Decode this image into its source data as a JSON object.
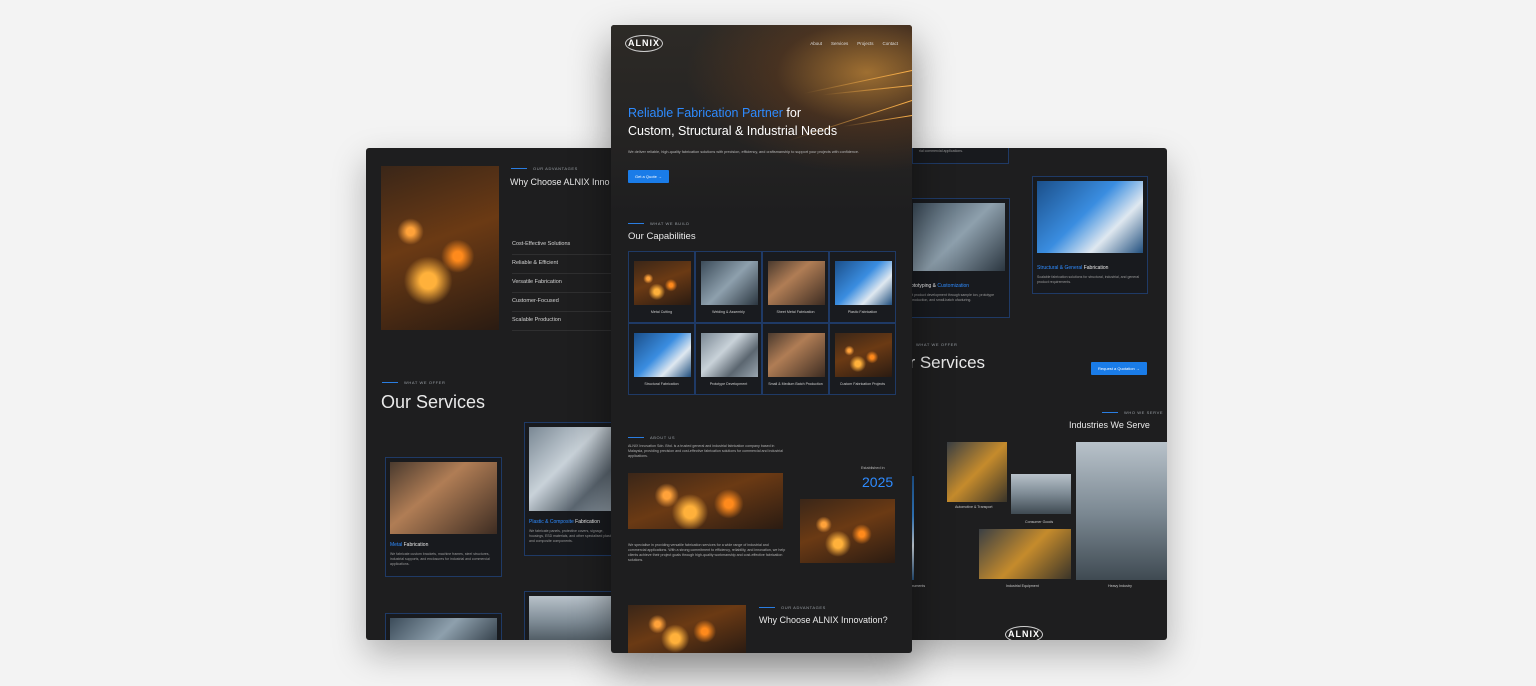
{
  "brand": {
    "logo_text": "ALNIX",
    "accent_color": "#2e8bff",
    "button_color": "#1a7ce8",
    "panel_bg": "#1e1e1f",
    "page_bg": "#f3f3f3"
  },
  "nav": {
    "items": [
      "About",
      "Services",
      "Projects",
      "Contact"
    ]
  },
  "hero": {
    "title_accent": "Reliable Fabrication Partner",
    "title_rest_1": " for",
    "title_line2": "Custom, Structural & Industrial Needs",
    "subtitle": "We deliver reliable, high-quality fabrication solutions with precision, efficiency, and craftsmanship to support your projects with confidence.",
    "cta": "Get a Quote →"
  },
  "capabilities": {
    "eyebrow": "WHAT WE BUILD",
    "title": "Our Capabilities",
    "items": [
      {
        "label": "Metal Cutting",
        "icon": "metal-cutting"
      },
      {
        "label": "Welding & Assembly",
        "icon": "welding"
      },
      {
        "label": "Sheet Metal Fabrication",
        "icon": "sheet-metal"
      },
      {
        "label": "Plastic Fabrication",
        "icon": "plastic"
      },
      {
        "label": "Structural Fabrication",
        "icon": "structural"
      },
      {
        "label": "Prototype Development",
        "icon": "prototype"
      },
      {
        "label": "Small & Medium Batch Production",
        "icon": "batch"
      },
      {
        "label": "Custom Fabrication Projects",
        "icon": "custom"
      }
    ]
  },
  "about": {
    "eyebrow": "ABOUT US",
    "text": "ALNIX Innovation Sdn. Bhd. is a trusted general and industrial fabrication company based in Malaysia, providing precision and cost-effective fabrication solutions for commercial and industrial applications.",
    "text2": "We specialise in providing versatile fabrication services for a wide range of industrial and commercial applications. With a strong commitment to efficiency, reliability, and innovation, we help clients achieve their project goals through high-quality workmanship and cost-effective fabrication solutions.",
    "established_label": "Established in",
    "established_year": "2025"
  },
  "why_choose": {
    "eyebrow": "OUR ADVANTAGES",
    "title": "Why Choose ALNIX Innovation?",
    "title_short": "Why Choose ALNIX Inno",
    "items": [
      "Cost-Effective Solutions",
      "Reliable & Efficient",
      "Versatile Fabrication",
      "Customer-Focused",
      "Scalable Production"
    ]
  },
  "services": {
    "eyebrow": "WHAT WE OFFER",
    "title": "Our Services",
    "title_cropped": "ur Services",
    "cta": "Request a Quotation →",
    "cards": [
      {
        "accent": "Metal",
        "rest": " Fabrication",
        "desc": "We fabricate custom brackets, machine frames, steel structures, industrial supports, and enclosures for industrial and commercial applications."
      },
      {
        "accent": "Plastic & Composite",
        "rest": " Fabrication",
        "desc": "We fabricate panels, protective covers, signage, housings, ESD materials, and other specialised plastic and composite components."
      },
      {
        "accent_pre": "ototyping & ",
        "accent": "Customization",
        "desc": "rt product development through sample ion, prototype production, and small-batch ufacturing."
      },
      {
        "accent": "Structural & General",
        "rest": " Fabrication",
        "desc": "Scalable fabrication solutions for structural, industrial, and general product requirements."
      }
    ],
    "top_snippet": "rial commercial applications."
  },
  "industries": {
    "eyebrow": "WHO WE SERVE",
    "title": "Industries We Serve",
    "items": [
      "Automotive & Transport",
      "Consumer Goods",
      "Industrial Equipment",
      "Heavy Industry",
      "ical Instruments"
    ]
  }
}
